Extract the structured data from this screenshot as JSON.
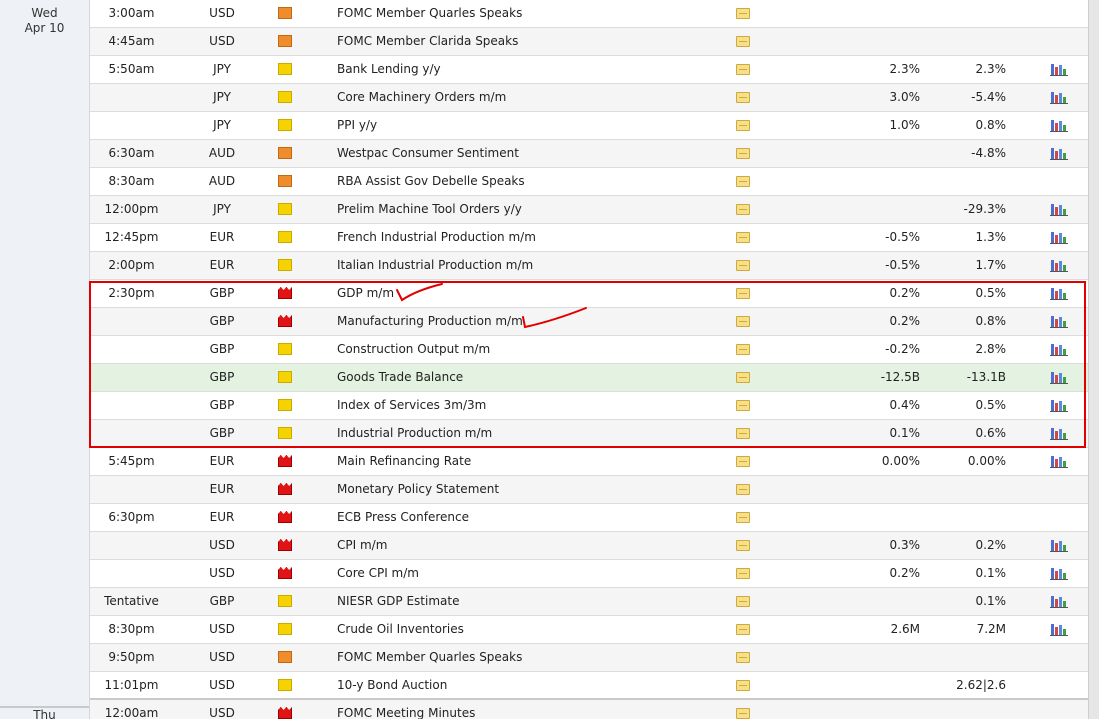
{
  "days": [
    {
      "weekday": "Wed",
      "date": "Apr 10"
    },
    {
      "weekday": "Thu",
      "date": ""
    }
  ],
  "events": [
    {
      "time": "3:00am",
      "currency": "USD",
      "impact": "medium",
      "event": "FOMC Member Quarles Speaks",
      "actual": "",
      "forecast": "",
      "graph": false
    },
    {
      "time": "4:45am",
      "currency": "USD",
      "impact": "medium",
      "event": "FOMC Member Clarida Speaks",
      "actual": "",
      "forecast": "",
      "graph": false
    },
    {
      "time": "5:50am",
      "currency": "JPY",
      "impact": "low",
      "event": "Bank Lending y/y",
      "actual": "2.3%",
      "forecast": "2.3%",
      "graph": true
    },
    {
      "time": "",
      "currency": "JPY",
      "impact": "low",
      "event": "Core Machinery Orders m/m",
      "actual": "3.0%",
      "forecast": "-5.4%",
      "graph": true
    },
    {
      "time": "",
      "currency": "JPY",
      "impact": "low",
      "event": "PPI y/y",
      "actual": "1.0%",
      "forecast": "0.8%",
      "graph": true
    },
    {
      "time": "6:30am",
      "currency": "AUD",
      "impact": "medium",
      "event": "Westpac Consumer Sentiment",
      "actual": "",
      "forecast": "-4.8%",
      "graph": true
    },
    {
      "time": "8:30am",
      "currency": "AUD",
      "impact": "medium",
      "event": "RBA Assist Gov Debelle Speaks",
      "actual": "",
      "forecast": "",
      "graph": false
    },
    {
      "time": "12:00pm",
      "currency": "JPY",
      "impact": "low",
      "event": "Prelim Machine Tool Orders y/y",
      "actual": "",
      "forecast": "-29.3%",
      "graph": true
    },
    {
      "time": "12:45pm",
      "currency": "EUR",
      "impact": "low",
      "event": "French Industrial Production m/m",
      "actual": "-0.5%",
      "forecast": "1.3%",
      "graph": true
    },
    {
      "time": "2:00pm",
      "currency": "EUR",
      "impact": "low",
      "event": "Italian Industrial Production m/m",
      "actual": "-0.5%",
      "forecast": "1.7%",
      "graph": true
    },
    {
      "time": "2:30pm",
      "currency": "GBP",
      "impact": "high",
      "event": "GDP m/m",
      "actual": "0.2%",
      "forecast": "0.5%",
      "graph": true
    },
    {
      "time": "",
      "currency": "GBP",
      "impact": "high",
      "event": "Manufacturing Production m/m",
      "actual": "0.2%",
      "forecast": "0.8%",
      "graph": true
    },
    {
      "time": "",
      "currency": "GBP",
      "impact": "low",
      "event": "Construction Output m/m",
      "actual": "-0.2%",
      "forecast": "2.8%",
      "graph": true
    },
    {
      "time": "",
      "currency": "GBP",
      "impact": "low",
      "event": "Goods Trade Balance",
      "actual": "-12.5B",
      "forecast": "-13.1B",
      "graph": true,
      "highlight": true
    },
    {
      "time": "",
      "currency": "GBP",
      "impact": "low",
      "event": "Index of Services 3m/3m",
      "actual": "0.4%",
      "forecast": "0.5%",
      "graph": true
    },
    {
      "time": "",
      "currency": "GBP",
      "impact": "low",
      "event": "Industrial Production m/m",
      "actual": "0.1%",
      "forecast": "0.6%",
      "graph": true
    },
    {
      "time": "5:45pm",
      "currency": "EUR",
      "impact": "high",
      "event": "Main Refinancing Rate",
      "actual": "0.00%",
      "forecast": "0.00%",
      "graph": true
    },
    {
      "time": "",
      "currency": "EUR",
      "impact": "high",
      "event": "Monetary Policy Statement",
      "actual": "",
      "forecast": "",
      "graph": false
    },
    {
      "time": "6:30pm",
      "currency": "EUR",
      "impact": "high",
      "event": "ECB Press Conference",
      "actual": "",
      "forecast": "",
      "graph": false
    },
    {
      "time": "",
      "currency": "USD",
      "impact": "high",
      "event": "CPI m/m",
      "actual": "0.3%",
      "forecast": "0.2%",
      "graph": true
    },
    {
      "time": "",
      "currency": "USD",
      "impact": "high",
      "event": "Core CPI m/m",
      "actual": "0.2%",
      "forecast": "0.1%",
      "graph": true
    },
    {
      "time": "Tentative",
      "currency": "GBP",
      "impact": "low",
      "event": "NIESR GDP Estimate",
      "actual": "",
      "forecast": "0.1%",
      "graph": true
    },
    {
      "time": "8:30pm",
      "currency": "USD",
      "impact": "low",
      "event": "Crude Oil Inventories",
      "actual": "2.6M",
      "forecast": "7.2M",
      "graph": true
    },
    {
      "time": "9:50pm",
      "currency": "USD",
      "impact": "medium",
      "event": "FOMC Member Quarles Speaks",
      "actual": "",
      "forecast": "",
      "graph": false
    },
    {
      "time": "11:01pm",
      "currency": "USD",
      "impact": "low",
      "event": "10-y Bond Auction",
      "actual": "",
      "forecast": "2.62|2.6",
      "graph": false
    },
    {
      "time": "12:00am",
      "currency": "USD",
      "impact": "high",
      "event": "FOMC Meeting Minutes",
      "actual": "",
      "forecast": "",
      "graph": false,
      "newDay": true
    }
  ],
  "colors": {
    "annotation": "#e00000",
    "highlight_row": "#e4f2e1"
  }
}
